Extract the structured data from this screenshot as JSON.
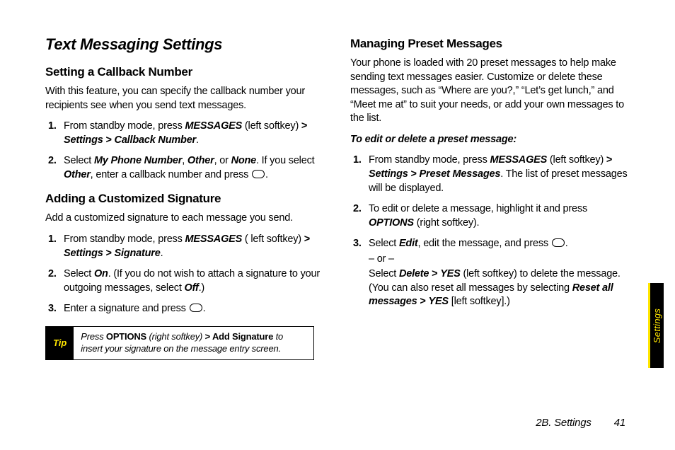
{
  "left": {
    "title": "Text Messaging Settings",
    "sec1": {
      "heading": "Setting a Callback Number",
      "intro": "With this feature, you can specify the callback number your recipients see when you send text messages.",
      "s1a": "From standby mode, press ",
      "s1b": "MESSAGES",
      "s1c": " (left softkey) ",
      "s1d": ">",
      "s1e": " Settings",
      "s1f": " > ",
      "s1g": "Callback Number",
      "s1h": ".",
      "s2a": "Select ",
      "s2b": "My Phone Number",
      "s2c": ", ",
      "s2d": "Other",
      "s2e": ", or ",
      "s2f": "None",
      "s2g": ". If you select ",
      "s2h": "Other",
      "s2i": ", enter a callback number and press ",
      "s2j": "."
    },
    "sec2": {
      "heading": "Adding a Customized Signature",
      "intro": "Add a customized signature to each message you send.",
      "s1a": "From standby mode, press ",
      "s1b": "MESSAGES",
      "s1c": " ( left softkey) ",
      "s1d": ">",
      "s1e": " Settings",
      "s1f": " > ",
      "s1g": "Signature",
      "s1h": ".",
      "s2a": "Select ",
      "s2b": "On",
      "s2c": ". (If you do not wish to attach a signature to your outgoing messages, select ",
      "s2d": "Off",
      "s2e": ".)",
      "s3a": "Enter a signature and press ",
      "s3b": "."
    },
    "tip": {
      "label": "Tip",
      "t1": "Press ",
      "t2": "OPTIONS",
      "t3": " (right softkey) ",
      "t4": ">",
      "t5": " Add Signature",
      "t6": " to insert your signature on the message entry screen."
    }
  },
  "right": {
    "heading": "Managing Preset Messages",
    "intro": "Your phone is loaded with 20 preset messages to help make sending text messages easier. Customize or delete these messages, such as “Where are you?,” “Let’s get lunch,” and “Meet me at” to suit your needs, or add your own messages to the list.",
    "pre": "To edit or delete a preset message:",
    "s1a": "From standby mode, press ",
    "s1b": "MESSAGES",
    "s1c": " (left softkey) ",
    "s1d": ">",
    "s1e": " Settings",
    "s1f": " > ",
    "s1g": "Preset Messages",
    "s1h": ". The list of preset messages will be displayed.",
    "s2a": "To edit or delete a message, highlight it and press ",
    "s2b": "OPTIONS",
    "s2c": " (right softkey).",
    "s3a": "Select ",
    "s3b": "Edit",
    "s3c": ", edit the message, and press ",
    "s3d": ".",
    "s3or": "– or –",
    "s3e": "Select ",
    "s3f": "Delete",
    "s3g": " > ",
    "s3h": "YES",
    "s3i": " (left softkey) to delete the message. (You can also reset all messages by selecting ",
    "s3j": "Reset all messages",
    "s3k": " > ",
    "s3l": "YES",
    "s3m": " [left softkey].)"
  },
  "tab": "Settings",
  "footer": {
    "section": "2B. Settings",
    "page": "41"
  }
}
